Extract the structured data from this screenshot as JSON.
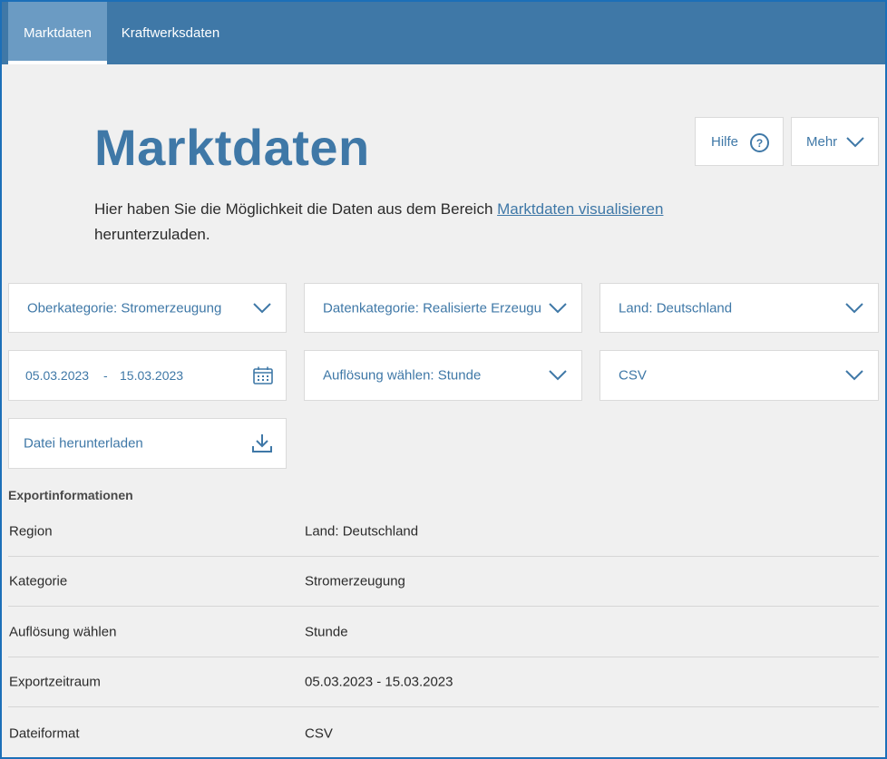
{
  "nav": {
    "tabs": [
      {
        "label": "Marktdaten",
        "active": true
      },
      {
        "label": "Kraftwerksdaten",
        "active": false
      }
    ]
  },
  "header": {
    "title": "Marktdaten",
    "help_label": "Hilfe",
    "more_label": "Mehr"
  },
  "intro": {
    "text_before": "Hier haben Sie die Möglichkeit die Daten aus dem Bereich ",
    "link_text": "Marktdaten visualisieren",
    "text_after": " herunterzuladen."
  },
  "filters": {
    "oberkategorie": "Oberkategorie: Stromerzeugung",
    "datenkategorie": "Datenkategorie: Realisierte Erzeugung",
    "land": "Land: Deutschland",
    "date_from": "05.03.2023",
    "date_separator": "-",
    "date_to": "15.03.2023",
    "aufloesung": "Auflösung wählen: Stunde",
    "format": "CSV"
  },
  "download": {
    "label": "Datei herunterladen"
  },
  "export": {
    "title": "Exportinformationen",
    "rows": [
      {
        "key": "Region",
        "value": "Land: Deutschland"
      },
      {
        "key": "Kategorie",
        "value": "Stromerzeugung"
      },
      {
        "key": "Auflösung wählen",
        "value": "Stunde"
      },
      {
        "key": "Exportzeitraum",
        "value": "05.03.2023 - 15.03.2023"
      },
      {
        "key": "Dateiformat",
        "value": "CSV"
      }
    ]
  },
  "colors": {
    "brand": "#3f78a7",
    "nav_active": "#6b9bc3",
    "background": "#f0f0f0"
  }
}
